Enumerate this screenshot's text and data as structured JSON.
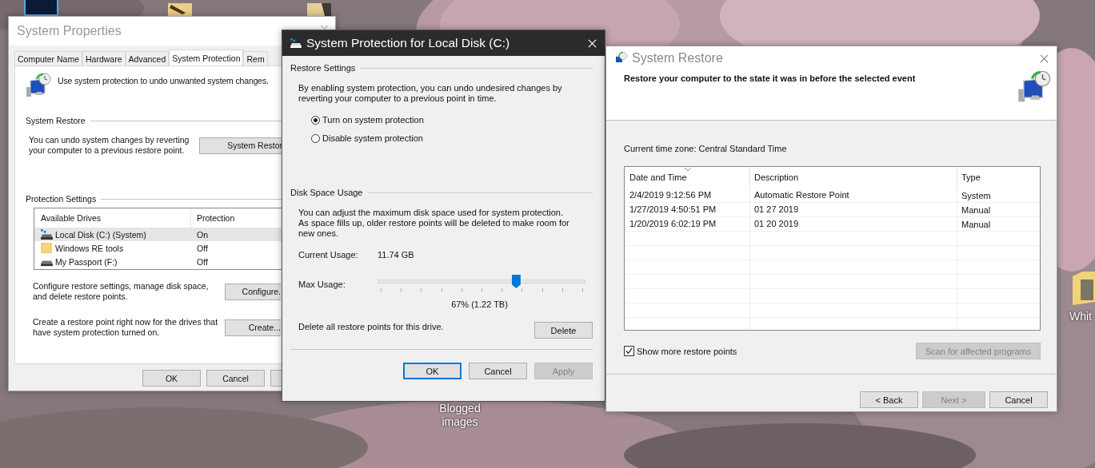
{
  "desktop": {
    "icons": [
      {
        "label": "Blogged images"
      },
      {
        "label": "Whit"
      }
    ]
  },
  "system_properties": {
    "title": "System Properties",
    "tabs": [
      {
        "label": "Computer Name",
        "selected": false
      },
      {
        "label": "Hardware",
        "selected": false
      },
      {
        "label": "Advanced",
        "selected": false
      },
      {
        "label": "System Protection",
        "selected": true
      },
      {
        "label": "Rem",
        "selected": false
      }
    ],
    "intro": "Use system protection to undo unwanted system changes.",
    "system_restore": {
      "heading": "System Restore",
      "text": "You can undo system changes by reverting your computer to a previous restore point.",
      "button": "System Restor"
    },
    "protection_settings": {
      "heading": "Protection Settings",
      "columns": [
        "Available Drives",
        "Protection"
      ],
      "drives": [
        {
          "name": "Local Disk (C:) (System)",
          "protection": "On",
          "kind": "system",
          "selected": true
        },
        {
          "name": "Windows RE tools",
          "protection": "Off",
          "kind": "folder",
          "selected": false
        },
        {
          "name": "My Passport (F:)",
          "protection": "Off",
          "kind": "drive",
          "selected": false
        }
      ],
      "configure_text": "Configure restore settings, manage disk space, and delete restore points.",
      "configure_button": "Configure.",
      "create_text": "Create a restore point right now for the drives that have system protection turned on.",
      "create_button": "Create..."
    },
    "buttons": [
      {
        "label": "OK"
      },
      {
        "label": "Cancel"
      }
    ]
  },
  "protection_dialog": {
    "title": "System Protection for Local Disk (C:)",
    "restore_settings": {
      "heading": "Restore Settings",
      "text": "By enabling system protection, you can undo undesired changes by reverting your computer to a previous point in time.",
      "options": [
        {
          "label": "Turn on system protection",
          "selected": true
        },
        {
          "label": "Disable system protection",
          "selected": false
        }
      ]
    },
    "disk_space": {
      "heading": "Disk Space Usage",
      "text": "You can adjust the maximum disk space used for system protection. As space fills up, older restore points will be deleted to make room for new ones.",
      "current_usage_label": "Current Usage:",
      "current_usage": "11.74 GB",
      "max_usage_label": "Max Usage:",
      "max_usage": {
        "level": 0.67
      },
      "max_usage_reading": "67% (1.22 TB)",
      "delete_text": "Delete all restore points for this drive.",
      "delete_button": "Delete"
    },
    "buttons": [
      {
        "label": "OK",
        "default": true,
        "disabled": false
      },
      {
        "label": "Cancel",
        "default": false,
        "disabled": false
      },
      {
        "label": "Apply",
        "default": false,
        "disabled": true
      }
    ]
  },
  "system_restore": {
    "title": "System Restore",
    "heading": "Restore your computer to the state it was in before the selected event",
    "time_zone": "Current time zone: Central Standard Time",
    "table": {
      "columns": [
        "Date and Time",
        "Description",
        "Type"
      ],
      "rows": [
        [
          "2/4/2019 9:12:56 PM",
          "Automatic Restore Point",
          "System"
        ],
        [
          "1/27/2019 4:50:51 PM",
          "01 27 2019",
          "Manual"
        ],
        [
          "1/20/2019 6:02:19 PM",
          "01 20 2019",
          "Manual"
        ]
      ]
    },
    "show_more": {
      "label": "Show more restore points",
      "checked": true
    },
    "scan_button": {
      "label": "Scan for affected programs",
      "disabled": true
    },
    "buttons": [
      {
        "label": "< Back",
        "disabled": false
      },
      {
        "label": "Next >",
        "disabled": true
      },
      {
        "label": "Cancel",
        "disabled": false
      }
    ]
  }
}
